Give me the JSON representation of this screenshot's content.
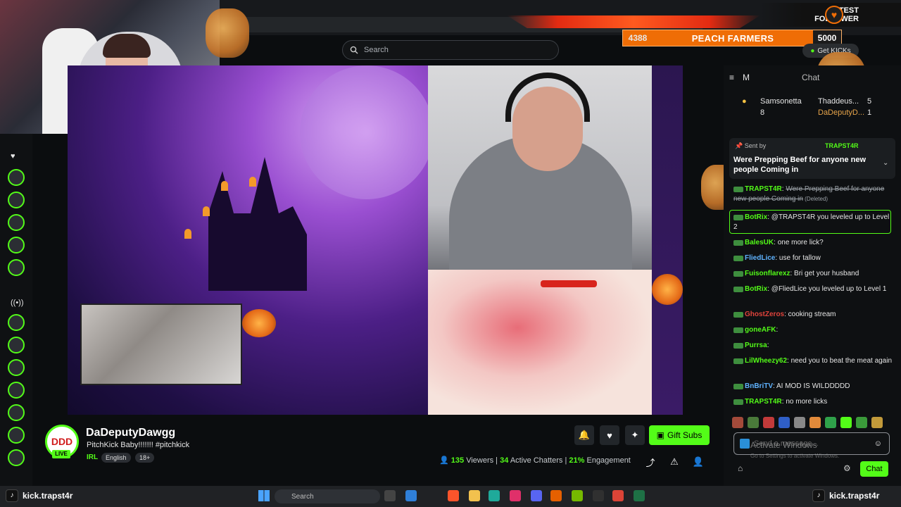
{
  "top": {
    "search_placeholder": "Search",
    "get_kicks_label": "Get KICKs",
    "latest_follower_line1": "LATEST",
    "latest_follower_line2": "FOLLOWER",
    "follow_goal": {
      "current": "4388",
      "name": "PEACH FARMERS",
      "target": "5000"
    }
  },
  "chat": {
    "header_letter": "M",
    "header_label": "Chat",
    "gifters": [
      {
        "rank": "1",
        "name": "Samsonetta",
        "count": "8"
      },
      {
        "rank": "2",
        "name": "Thaddeus...",
        "count": "5"
      },
      {
        "rank": "3",
        "name": "DaDeputyD...",
        "count": "1"
      }
    ],
    "pinned": {
      "sent_by": "Sent by",
      "sender": "TRAPST4R",
      "message": "Were Prepping Beef for anyone new people Coming in"
    },
    "messages": [
      {
        "user": "TRAPST4R",
        "text": "Were Prepping Beef for anyone new people Coming in",
        "note": "(Deleted)",
        "color": "#53fc18"
      },
      {
        "user": "BotRix",
        "text": ": @TRAPST4R you leveled up to Level 2",
        "color": "#53fc18"
      },
      {
        "user": "BalesUK",
        "text": ": one more lick?",
        "color": "#53fc18"
      },
      {
        "user": "FliedLice",
        "text": ": use for tallow",
        "color": "#5fb3ff"
      },
      {
        "user": "Fuisonflarexz",
        "text": ": Bri get your husband",
        "color": "#53fc18"
      },
      {
        "user": "BotRix",
        "text": ": @FliedLice you leveled up to Level 1",
        "color": "#53fc18"
      },
      {
        "user": "GhostZeros",
        "text": ": cooking stream",
        "color": "#e0443c"
      },
      {
        "user": "goneAFK",
        "text": ":",
        "color": "#53fc18"
      },
      {
        "user": "Purrsa",
        "text": ":",
        "color": "#53fc18"
      },
      {
        "user": "LilWheezy62",
        "text": ": need you to beat the meat again",
        "color": "#53fc18"
      },
      {
        "user": "BnBriTV",
        "text": ": AI MOD IS WILDDDDD",
        "color": "#5fb3ff"
      },
      {
        "user": "TRAPST4R",
        "text": ": no more licks",
        "color": "#53fc18"
      }
    ],
    "input_placeholder": "Send a message...",
    "activate_windows": "Activate Windows",
    "activate_hint": "Go to Settings to activate Windows.",
    "send_label": "Chat"
  },
  "channel": {
    "avatar_text": "DDD",
    "live_label": "LIVE",
    "name": "DaDeputyDawgg",
    "title": "PitchKick Baby!!!!!!! #pitchkick",
    "category": "IRL",
    "tags": [
      "English",
      "18+"
    ],
    "gift_subs_label": "Gift Subs",
    "viewers": "135",
    "viewers_label": "Viewers",
    "chatters": "34",
    "chatters_label": "Active Chatters",
    "engagement": "21%",
    "engagement_label": "Engagement"
  },
  "taskbar": {
    "left_handle": "kick.trapst4r",
    "right_handle": "kick.trapst4r",
    "search_label": "Search"
  },
  "colors": {
    "accent": "#53fc18",
    "follower_bar": "#ef6d06"
  }
}
